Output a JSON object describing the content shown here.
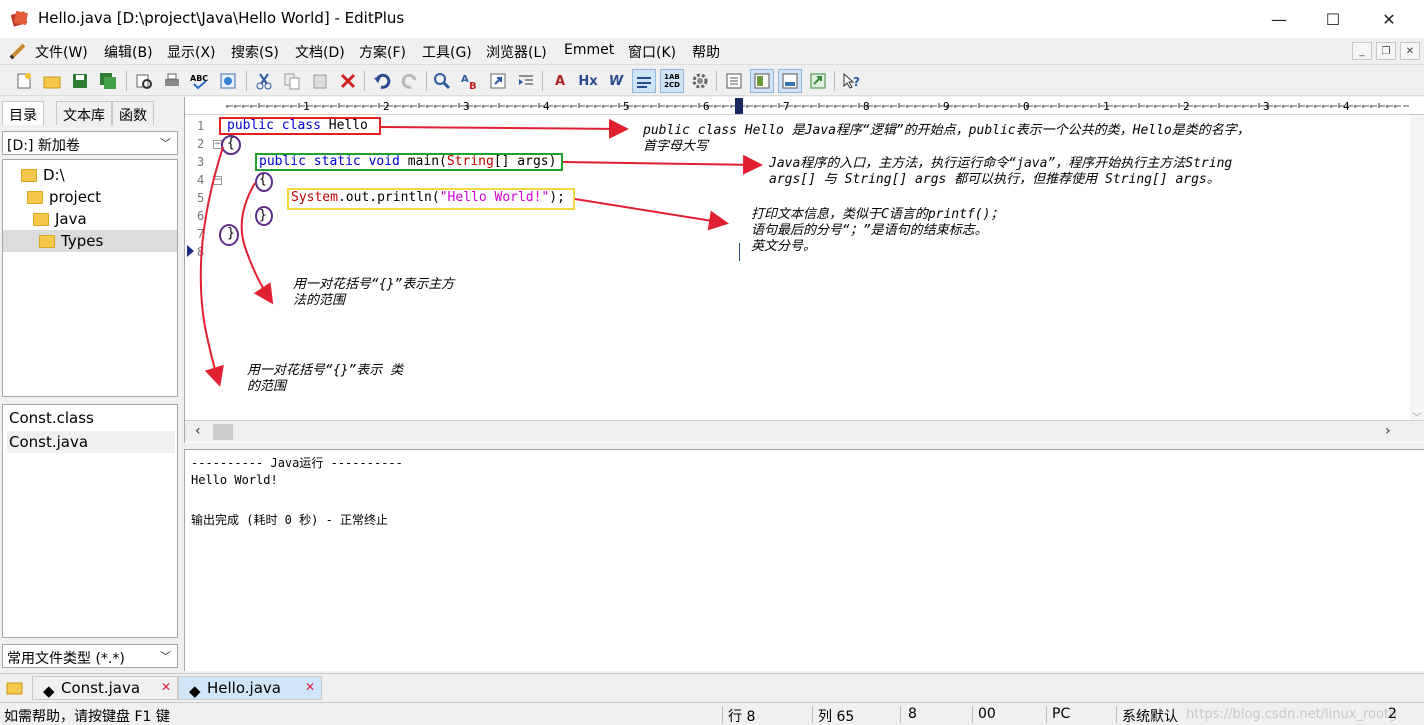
{
  "window": {
    "title": "Hello.java [D:\\project\\Java\\Hello World] - EditPlus",
    "minimize": "—",
    "maximize": "☐",
    "close": "✕"
  },
  "menu": [
    "文件(W)",
    "编辑(B)",
    "显示(X)",
    "搜索(S)",
    "文档(D)",
    "方案(F)",
    "工具(G)",
    "浏览器(L)",
    "Emmet",
    "窗口(K)",
    "帮助"
  ],
  "mdi": {
    "minimize": "_",
    "restore": "❐",
    "close": "✕"
  },
  "toolbar_icons": [
    "new-file-icon",
    "open-folder-icon",
    "save-icon",
    "save-all-icon",
    "print-preview-icon",
    "print-icon",
    "spell-check-icon",
    "browser-preview-icon",
    "cut-icon",
    "copy-icon",
    "paste-icon",
    "delete-icon",
    "undo-icon",
    "redo-icon",
    "find-icon",
    "replace-icon",
    "goto-icon",
    "indent-icon",
    "font-icon",
    "hex-icon",
    "word-wrap-icon",
    "line-number-icon",
    "ruler-icon",
    "settings-icon",
    "directory-icon",
    "cliptext-icon",
    "output-icon",
    "fullscreen-icon",
    "help-icon"
  ],
  "toolbar_text": {
    "font": "A",
    "hex": "Hx",
    "wrap": "W",
    "lineno": "1AB\n2CD"
  },
  "left_tabs": [
    "目录",
    "文本库",
    "函数"
  ],
  "drive_select": "[D:] 新加卷",
  "tree": [
    "D:\\",
    "project",
    "Java",
    "Types"
  ],
  "files": [
    "Const.class",
    "Const.java"
  ],
  "filetype_select": "常用文件类型 (*.*)",
  "ruler_labels": [
    "1",
    "2",
    "3",
    "4",
    "5",
    "6",
    "7",
    "8",
    "9",
    "0",
    "1",
    "2",
    "3",
    "4"
  ],
  "line_numbers": [
    "1",
    "2",
    "3",
    "4",
    "5",
    "6",
    "7",
    "8"
  ],
  "code": {
    "l1_kw": "public class",
    "l1_name": " Hello",
    "l2": "{",
    "l3_kw": "public static void",
    "l3_mid": " main(",
    "l3_type": "String",
    "l3_end": "[] args)",
    "l4": "{",
    "l5_pre": "System",
    "l5_mid": ".out.println(",
    "l5_str": "\"Hello World!\"",
    "l5_end": ");",
    "l6": "}",
    "l7": "}"
  },
  "annotations": {
    "a1_l1": "public class Hello 是Java程序“逻辑”的开始点，public表示一个公共的类，Hello是类的名字，",
    "a1_l2": "首字母大写",
    "a2_l1": "Java程序的入口，主方法，执行运行命令“java”，程序开始执行主方法String",
    "a2_l2": "args[] 与 String[] args 都可以执行，但推荐使用 String[] args。",
    "a3_l1": "打印文本信息，类似于C语言的printf()；",
    "a3_l2": "语句最后的分号“；”是语句的结束标志。",
    "a3_l3": "英文分号。",
    "a4_l1": "用一对花括号“{}”表示主方",
    "a4_l2": "法的范围",
    "a5_l1": "用一对花括号“{}”表示 类",
    "a5_l2": "的范围"
  },
  "output": {
    "header": "---------- Java运行 ----------",
    "line1": "Hello World!",
    "line2": "输出完成 (耗时 0 秒) - 正常终止"
  },
  "doc_tabs": [
    "Const.java",
    "Hello.java"
  ],
  "status": {
    "help": "如需帮助，请按键盘 F1 键",
    "row": "行 8",
    "col": "列 65",
    "num": "8",
    "code": "00",
    "mode": "PC",
    "encoding": "系统默认",
    "watermark": "https://blog.csdn.net/linux_rootg",
    "page": "2"
  },
  "colors": {
    "red_box": "#e02020",
    "green_box": "#22a030",
    "yellow_box": "#f5d840",
    "oval": "#5c2e8a",
    "arrow": "#e02030"
  }
}
